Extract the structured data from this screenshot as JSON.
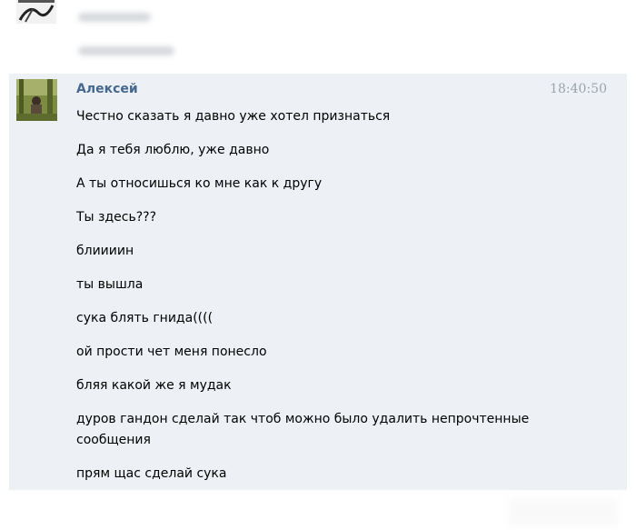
{
  "message": {
    "author": "Алексей",
    "time": "18:40:50",
    "lines": [
      "Честно сказать я давно уже хотел признаться",
      "Да я тебя люблю, уже давно",
      "А ты относишься ко мне как к другу",
      "Ты здесь???",
      "блиииин",
      "ты вышла",
      "сука блять гнида((((",
      "ой прости чет меня понесло",
      "бляя какой же я мудак",
      "дуров гандон сделай так чтоб можно было удалить непрочтенные сообщения",
      "прям щас сделай сука"
    ]
  },
  "colors": {
    "author": "#45688e",
    "time": "#9aa3ad",
    "block_background": "#edf1f5"
  }
}
